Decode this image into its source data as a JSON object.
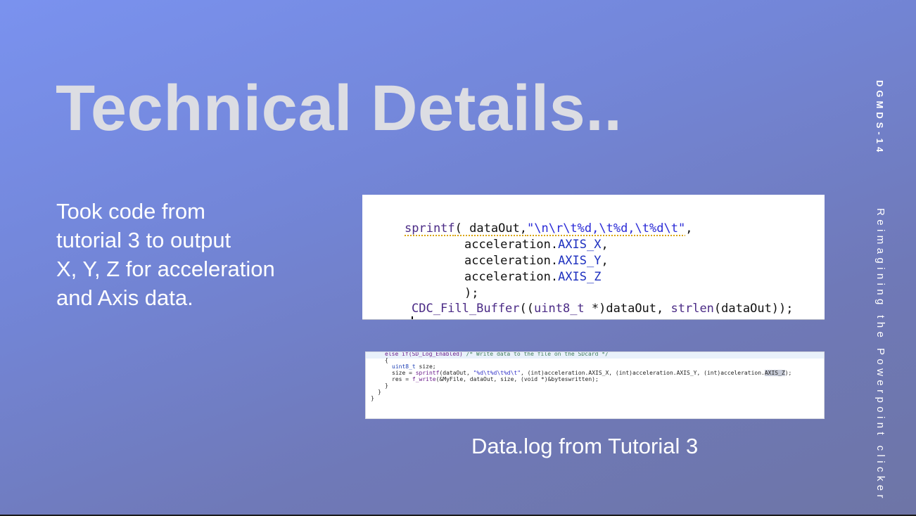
{
  "slide": {
    "title": "Technical Details..",
    "body_lines": [
      "Took code from",
      "tutorial 3 to  output",
      "X, Y, Z  for acceleration",
      "and Axis data."
    ],
    "side_course": "DGMDS-14",
    "side_project": "Reimagining the Powerpoint clicker",
    "caption": "Data.log from Tutorial 3",
    "colors": {
      "background_top": "#7a92ef",
      "background_bottom": "#6e75a6",
      "title": "#dcdde3",
      "text": "#ffffff"
    }
  },
  "code_snippet_1": {
    "line1_fn": "sprintf",
    "line1_args": "( dataOut,",
    "line1_str": "\"\\n\\r\\t%d,\\t%d,\\t%d\\t\"",
    "line1_end": ",",
    "line2_prefix": "acceleration.",
    "line2_field": "AXIS_X",
    "line2_end": ",",
    "line3_prefix": "acceleration.",
    "line3_field": "AXIS_Y",
    "line3_end": ",",
    "line4_prefix": "acceleration.",
    "line4_field": "AXIS_Z",
    "line5": ");",
    "line6_fn": "CDC_Fill_Buffer",
    "line6_rest_a": "((",
    "line6_type": "uint8_t",
    "line6_rest_b": " *)dataOut, ",
    "line6_fn2": "strlen",
    "line6_rest_c": "(dataOut));"
  },
  "code_snippet_2": {
    "line1_a": "else if(SD_Log_Enabled) ",
    "line1_comment": "/* Write data to the file on the SDcard */",
    "line2": "{",
    "line3_type": "uint8_t",
    "line3_rest": " size;",
    "line4_a": "size = ",
    "line4_fn": "sprintf",
    "line4_b": "(dataOut, ",
    "line4_str": "\"%d\\t%d\\t%d\\t\"",
    "line4_c": ", (int)acceleration.AXIS_X, (int)acceleration.AXIS_Y, (int)acceleration.",
    "line4_hl": "AXIS_Z",
    "line4_d": ");",
    "line5_a": "res = ",
    "line5_fn": "f_write",
    "line5_b": "(&MyFile, dataOut, size, (void *)&byteswritten);",
    "line6": "}",
    "line7": "}",
    "line8": "}"
  }
}
